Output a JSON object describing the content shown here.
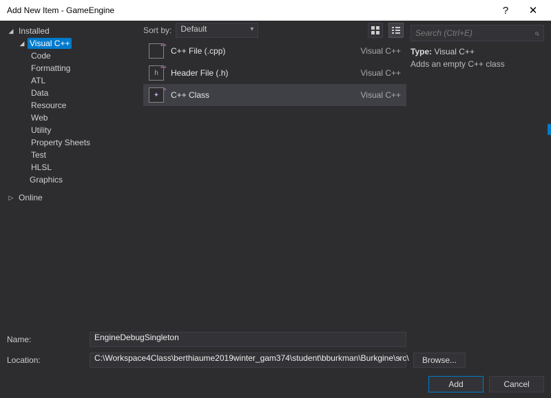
{
  "title": "Add New Item - GameEngine",
  "tree": {
    "installed": "Installed",
    "vcpp": "Visual C++",
    "children": [
      "Code",
      "Formatting",
      "ATL",
      "Data",
      "Resource",
      "Web",
      "Utility",
      "Property Sheets",
      "Test",
      "HLSL"
    ],
    "graphics": "Graphics",
    "online": "Online"
  },
  "sort": {
    "label": "Sort by:",
    "value": "Default"
  },
  "templates": [
    {
      "icon": "[ ]",
      "name": "C++ File (.cpp)",
      "lang": "Visual C++"
    },
    {
      "icon": "h",
      "name": "Header File (.h)",
      "lang": "Visual C++"
    },
    {
      "icon": "⤧",
      "name": "C++ Class",
      "lang": "Visual C++"
    }
  ],
  "search": {
    "placeholder": "Search (Ctrl+E)"
  },
  "detail": {
    "type_label": "Type:",
    "type_value": "Visual C++",
    "desc": "Adds an empty C++ class"
  },
  "form": {
    "name_label": "Name:",
    "name_value": "EngineDebugSingleton",
    "loc_label": "Location:",
    "loc_value": "C:\\Workspace4Class\\berthiaume2019winter_gam374\\student\\bburkman\\Burkgine\\src\\",
    "browse": "Browse..."
  },
  "buttons": {
    "add": "Add",
    "cancel": "Cancel"
  }
}
